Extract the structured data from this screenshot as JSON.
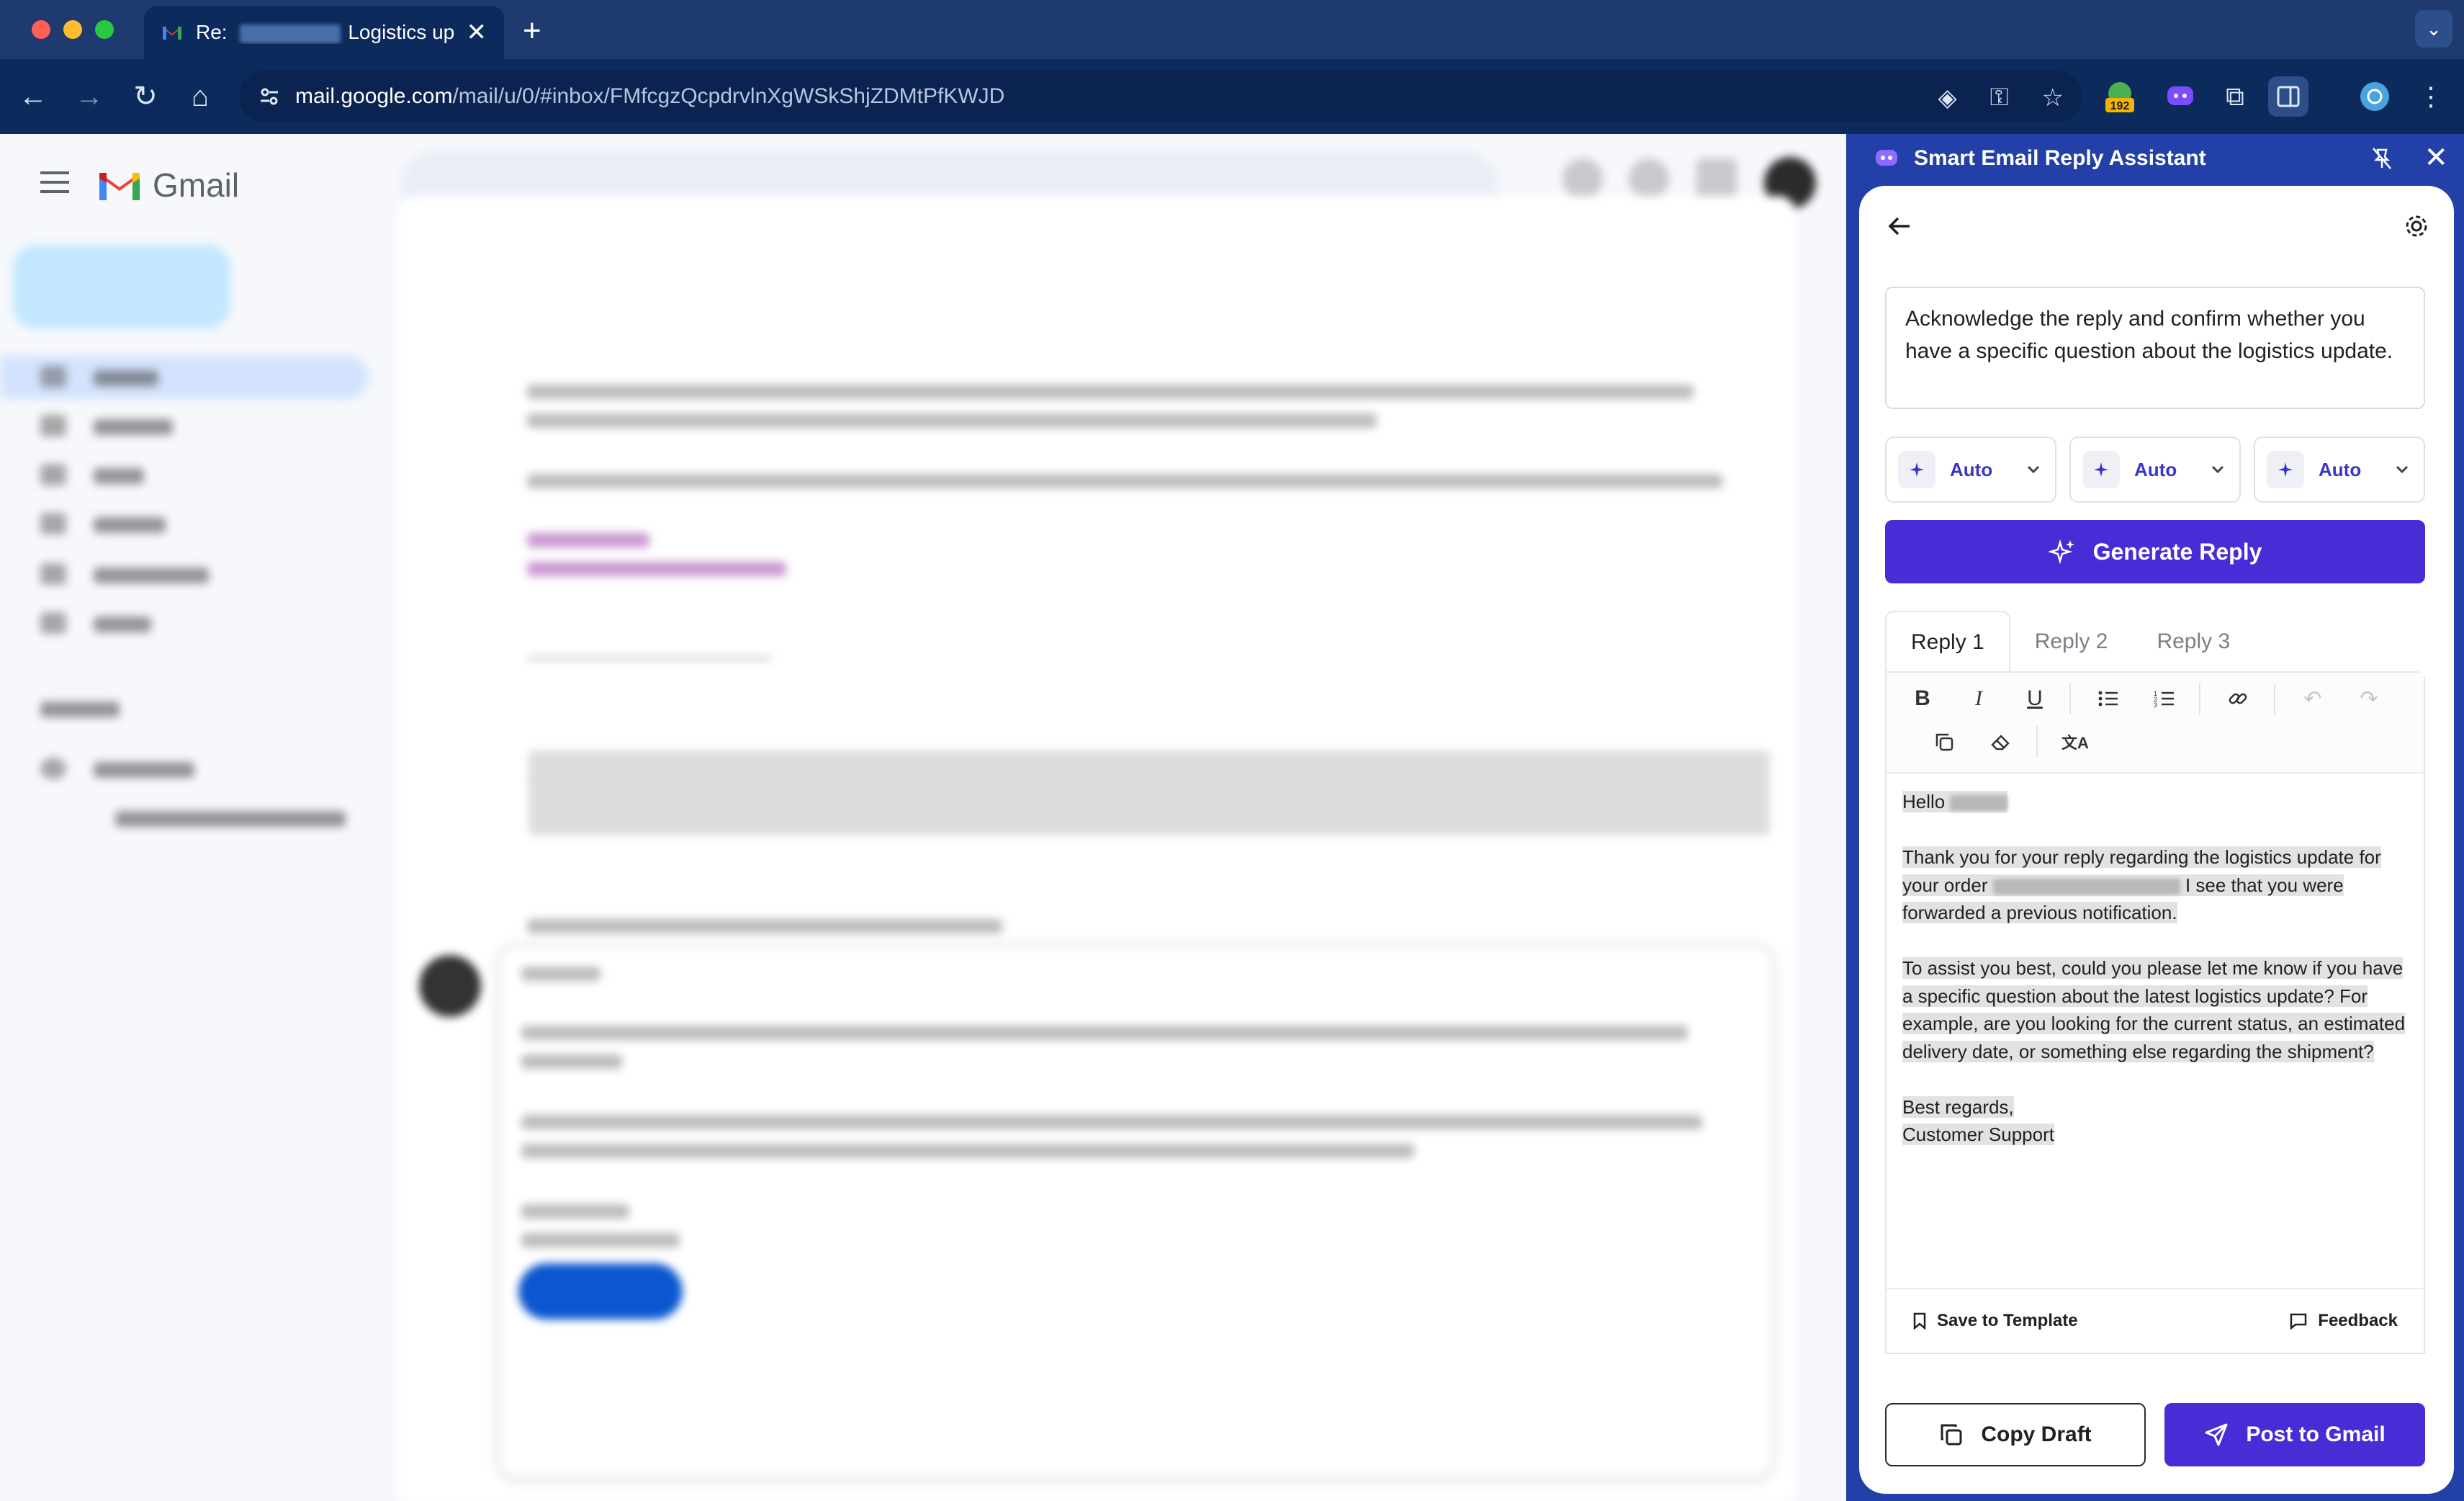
{
  "browser": {
    "tab_title_prefix": "Re: ",
    "tab_title_suffix": "Logistics up",
    "url_host": "mail.google.com",
    "url_path": "/mail/u/0/#inbox/FMfcgzQcpdrvlnXgWSkShjZDMtPfKWJD",
    "extension_badge": "192"
  },
  "gmail": {
    "logo_text": "Gmail"
  },
  "panel": {
    "title": "Smart Email Reply Assistant",
    "prompt_text": "Acknowledge the reply and confirm whether you have a specific question about the logistics update.",
    "selectors": [
      {
        "label": "Auto"
      },
      {
        "label": "Auto"
      },
      {
        "label": "Auto"
      }
    ],
    "generate_label": "Generate Reply",
    "tabs": [
      {
        "label": "Reply 1"
      },
      {
        "label": "Reply 2"
      },
      {
        "label": "Reply 3"
      }
    ],
    "reply": {
      "greeting": "Hello",
      "p1_a": "Thank you for your reply regarding the logistics update for your order",
      "p1_b": "I see that you were forwarded a previous notification.",
      "p2": "To assist you best, could you please let me know if you have a specific question about the latest logistics update? For example, are you looking for the current status, an estimated delivery date, or something else regarding the shipment?",
      "signoff": "Best regards,",
      "signature": "Customer Support"
    },
    "save_template_label": "Save to Template",
    "feedback_label": "Feedback",
    "copy_draft_label": "Copy Draft",
    "post_label": "Post to Gmail"
  },
  "colors": {
    "panel_header": "#2340a8",
    "primary_button": "#4a2cd6",
    "browser_frame": "#0d2a5c"
  }
}
